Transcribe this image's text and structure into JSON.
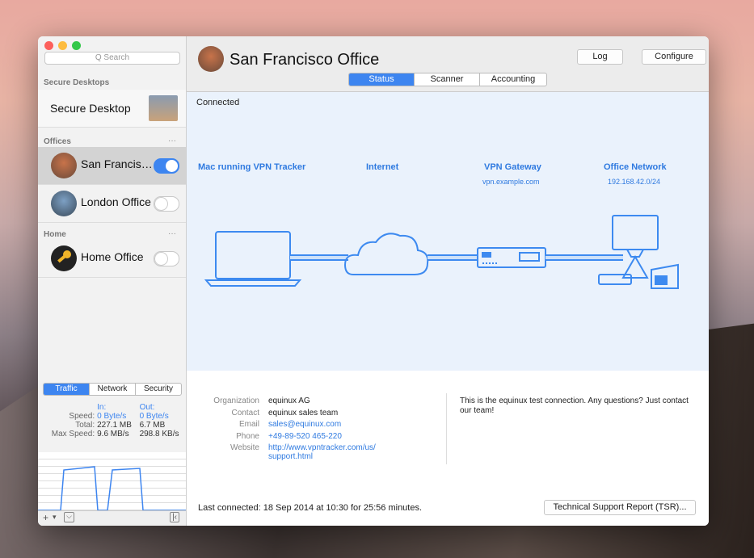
{
  "sidebar": {
    "search_placeholder": "Q Search",
    "sections": {
      "secure": "Secure Desktops",
      "offices": "Offices",
      "home": "Home",
      "more": "···"
    },
    "items": [
      {
        "label": "Secure Desktop"
      },
      {
        "label": "San Francis…",
        "on": true
      },
      {
        "label": "London Office",
        "on": false
      },
      {
        "label": "Home Office",
        "on": false
      }
    ],
    "stats_tabs": [
      "Traffic",
      "Network",
      "Security"
    ],
    "stats": {
      "in_label": "In:",
      "out_label": "Out:",
      "rows": [
        {
          "k": "Speed:",
          "in": "0 Byte/s",
          "out": "0 Byte/s"
        },
        {
          "k": "Total:",
          "in": "227.1 MB",
          "out": "6.7 MB"
        },
        {
          "k": "Max Speed:",
          "in": "9.6 MB/s",
          "out": "298.8 KB/s"
        }
      ]
    },
    "bottom": {
      "add": "+",
      "chevron": "▾",
      "menu": "⌵",
      "collapse": "|‹"
    }
  },
  "header": {
    "title": "San Francisco Office",
    "log": "Log",
    "configure": "Configure",
    "tabs": [
      "Status",
      "Scanner",
      "Accounting"
    ]
  },
  "diagram": {
    "status": "Connected",
    "mac": "Mac running VPN Tracker",
    "internet": "Internet",
    "gateway": "VPN Gateway",
    "gateway_host": "vpn.example.com",
    "network": "Office Network",
    "network_addr": "192.168.42.0/24"
  },
  "info": {
    "org_k": "Organization",
    "org_v": "equinux AG",
    "contact_k": "Contact",
    "contact_v": "equinux sales team",
    "email_k": "Email",
    "email_v": "sales@equinux.com",
    "phone_k": "Phone",
    "phone_v": "+49-89-520 465-220",
    "web_k": "Website",
    "web_v1": "http://www.vpntracker.com/us/",
    "web_v2": "support.html",
    "note": "This is the equinux test connection. Any questions? Just contact our team!",
    "last": "Last connected: 18 Sep 2014 at 10:30 for 25:56 minutes.",
    "tsr": "Technical Support Report (TSR)..."
  },
  "colors": {
    "accent": "#3d85f0",
    "diagram_bg": "#eaf2fc",
    "close": "#fc605c",
    "min": "#fdbc40",
    "max": "#34c84a"
  }
}
